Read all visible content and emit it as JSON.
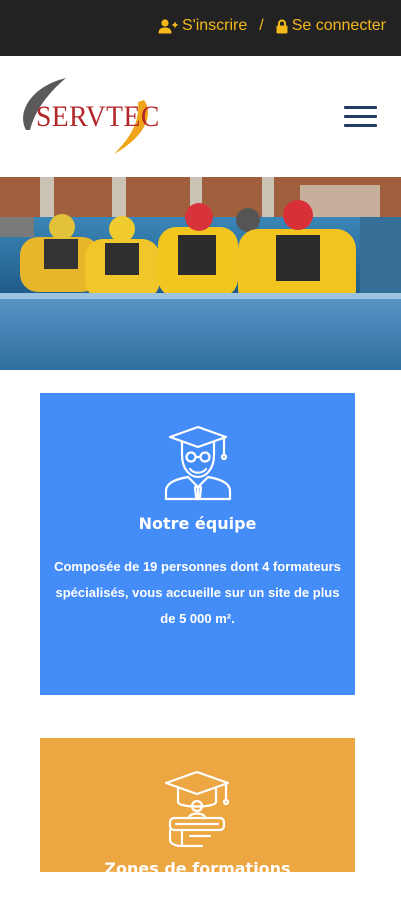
{
  "topbar": {
    "register_label": "S'inscrire",
    "separator": "/",
    "login_label": "Se connecter",
    "accent_color": "#f5b81b"
  },
  "header": {
    "logo_text": "SERVTEC",
    "menu_icon": "hamburger-icon"
  },
  "hero": {
    "icon": "photo"
  },
  "cards": [
    {
      "icon": "graduate-teacher-icon",
      "title": "Notre équipe",
      "text": "Composée de 19 personnes dont 4 formateurs spécialisés, vous accueille sur un site de plus de 5 000 m².",
      "color": "#448cf8"
    },
    {
      "icon": "graduation-diploma-icon",
      "title": "Zones de formations",
      "color": "#eca642"
    }
  ]
}
